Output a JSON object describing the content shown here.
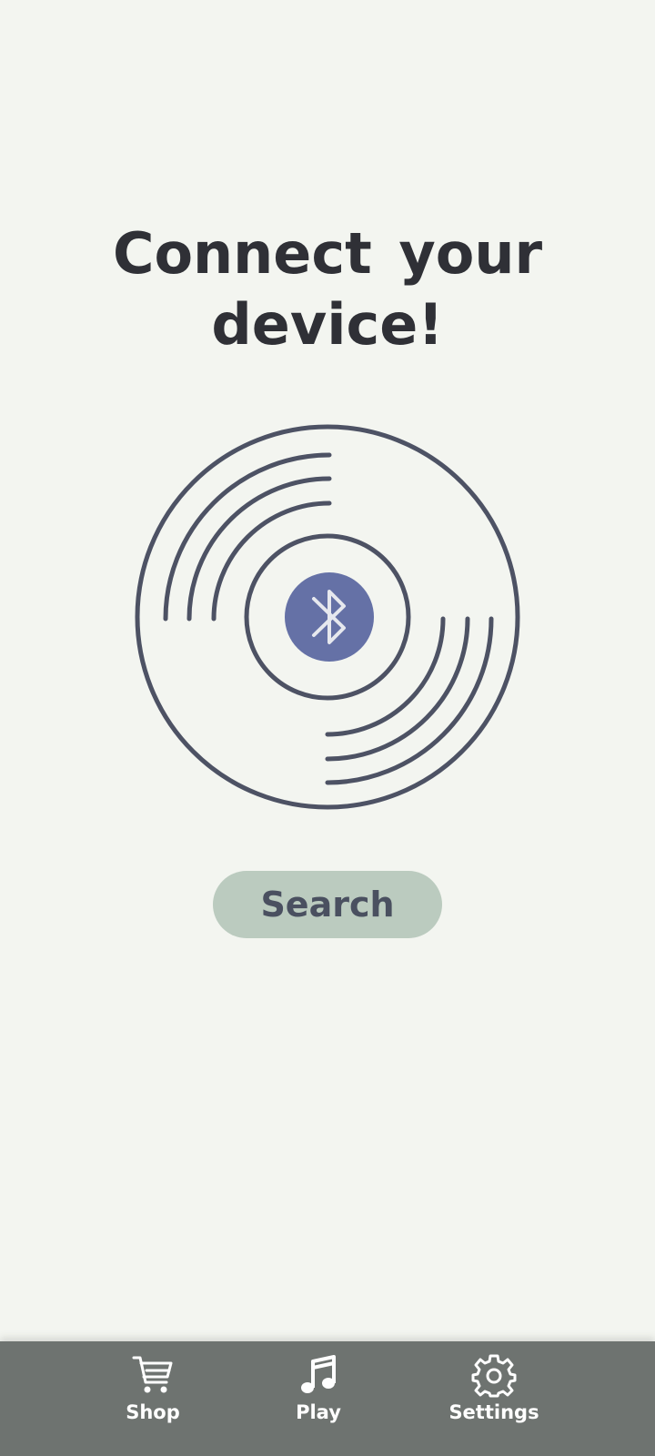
{
  "heading": {
    "line1": "Connect your",
    "line2": "device!"
  },
  "disc": {
    "center_icon": "bluetooth-icon",
    "ring_color": "#4d5264",
    "center_color": "#6571a6"
  },
  "search": {
    "label": "Search",
    "color": "#bbcbbf"
  },
  "bottom_nav": {
    "background": "#6e7370",
    "items": [
      {
        "label": "Shop",
        "icon": "cart-icon"
      },
      {
        "label": "Play",
        "icon": "music-note-icon"
      },
      {
        "label": "Settings",
        "icon": "gear-icon"
      }
    ]
  }
}
